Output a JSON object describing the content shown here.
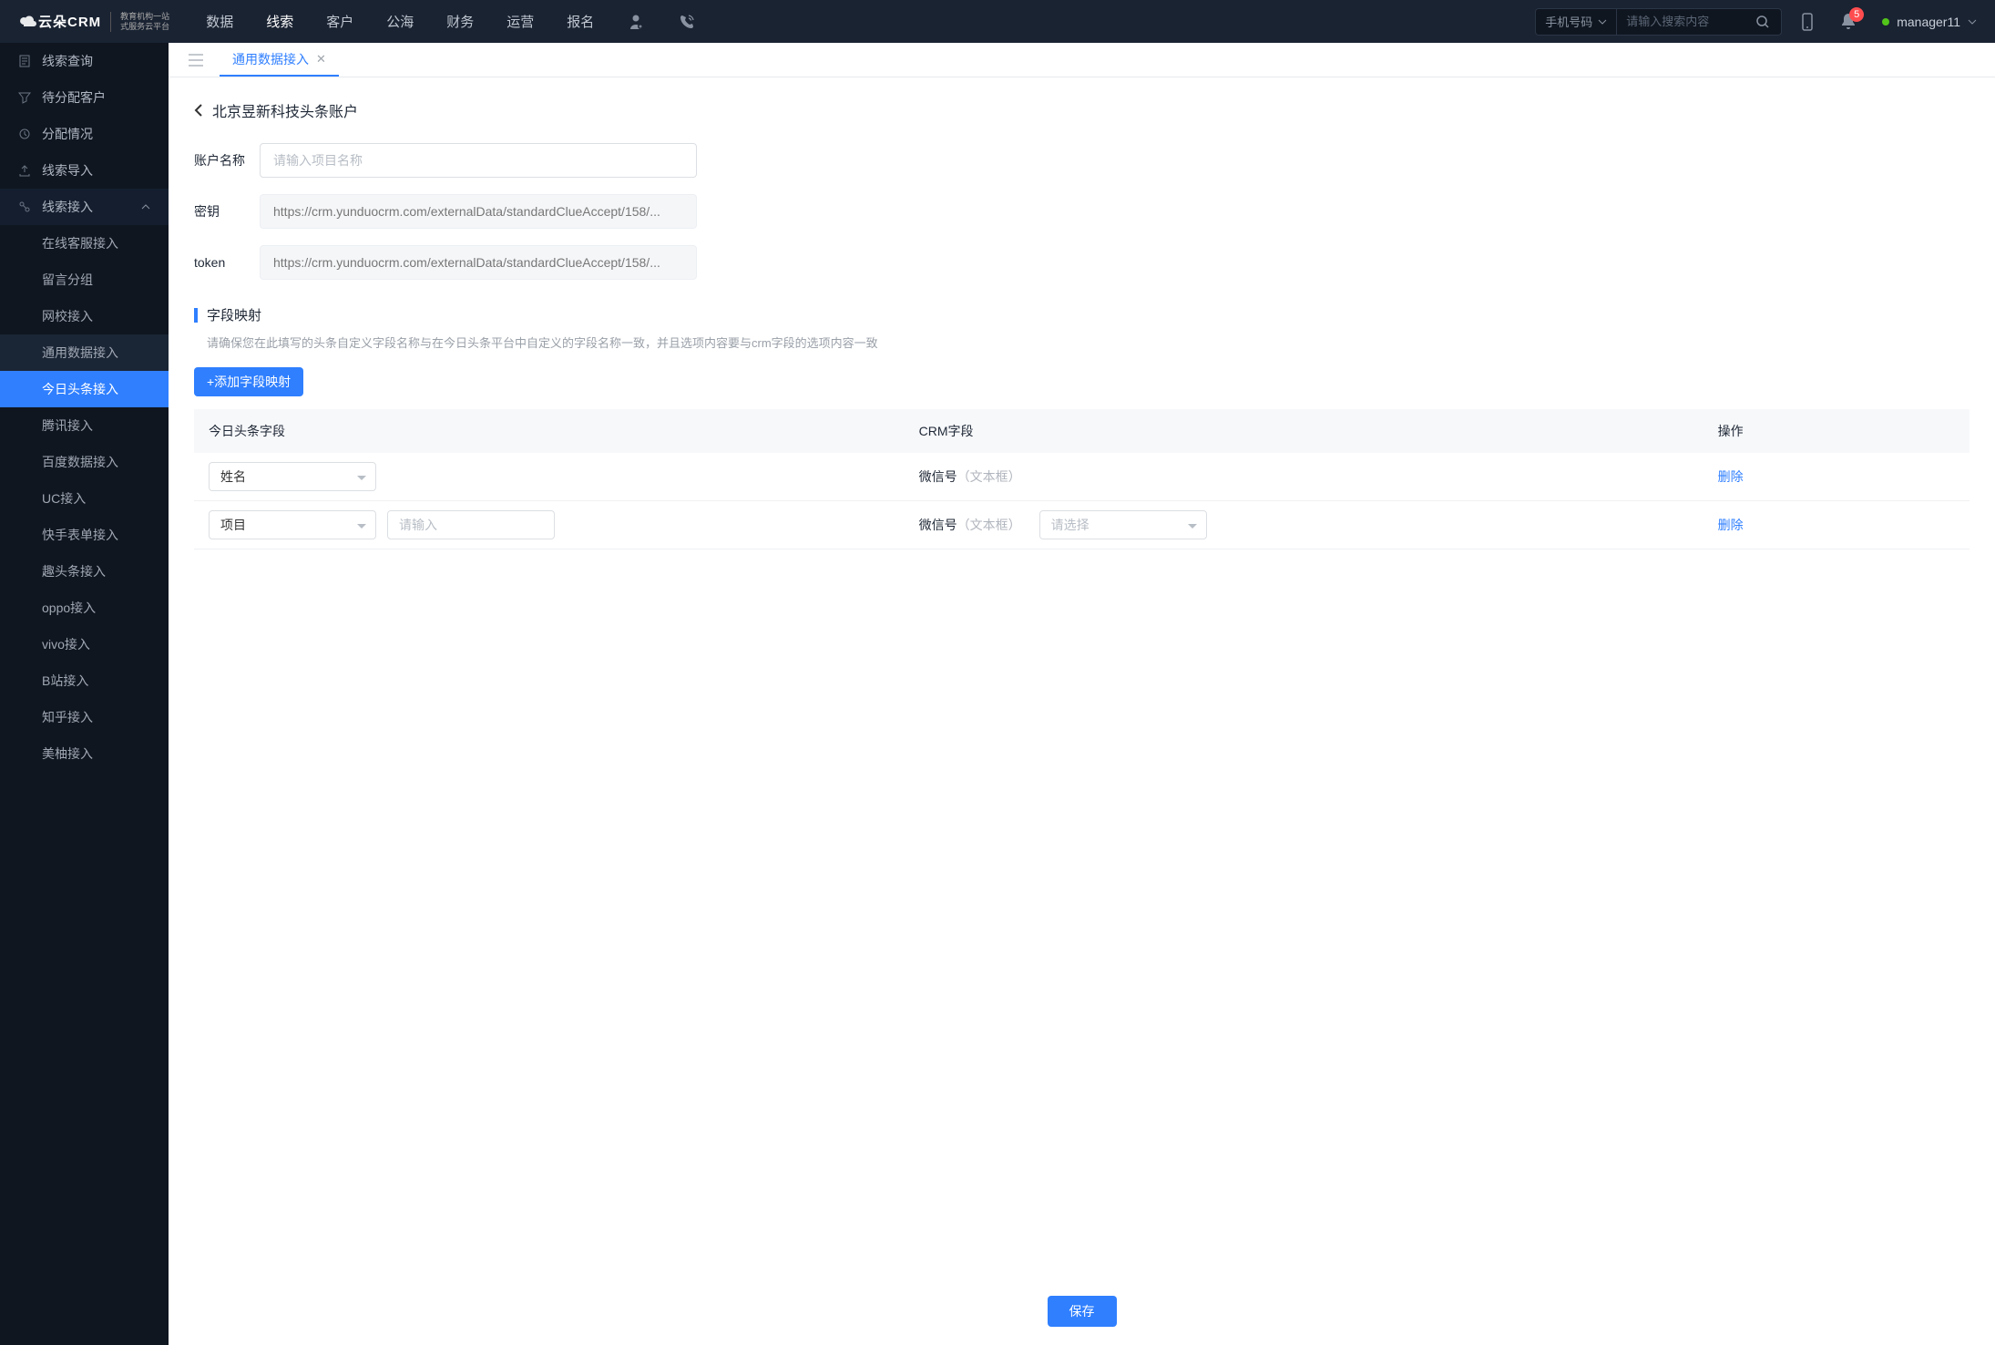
{
  "header": {
    "logo_main": "云朵CRM",
    "logo_sub_line1": "教育机构一站",
    "logo_sub_line2": "式服务云平台",
    "nav": [
      "数据",
      "线索",
      "客户",
      "公海",
      "财务",
      "运营",
      "报名"
    ],
    "nav_active": "线索",
    "search_select": "手机号码",
    "search_placeholder": "请输入搜索内容",
    "notif_count": "5",
    "user_name": "manager11"
  },
  "sidebar": {
    "items": [
      {
        "label": "线索查询",
        "icon": "doc-icon"
      },
      {
        "label": "待分配客户",
        "icon": "filter-icon"
      },
      {
        "label": "分配情况",
        "icon": "clock-icon"
      },
      {
        "label": "线索导入",
        "icon": "upload-icon"
      }
    ],
    "expanded_label": "线索接入",
    "subs": [
      "在线客服接入",
      "留言分组",
      "网校接入",
      "通用数据接入",
      "今日头条接入",
      "腾讯接入",
      "百度数据接入",
      "UC接入",
      "快手表单接入",
      "趣头条接入",
      "oppo接入",
      "vivo接入",
      "B站接入",
      "知乎接入",
      "美柚接入"
    ],
    "sub_active": "今日头条接入"
  },
  "tabs": {
    "0": {
      "label": "通用数据接入"
    }
  },
  "page": {
    "title": "北京昱新科技头条账户",
    "form": {
      "name_label": "账户名称",
      "name_placeholder": "请输入项目名称",
      "key_label": "密钥",
      "key_value": "https://crm.yunduocrm.com/externalData/standardClueAccept/158/...",
      "token_label": "token",
      "token_value": "https://crm.yunduocrm.com/externalData/standardClueAccept/158/..."
    },
    "mapping": {
      "title": "字段映射",
      "desc": "请确保您在此填写的头条自定义字段名称与在今日头条平台中自定义的字段名称一致，并且选项内容要与crm字段的选项内容一致",
      "add_btn": "+添加字段映射",
      "cols": [
        "今日头条字段",
        "CRM字段",
        "操作"
      ],
      "rows": [
        {
          "tt_field": "姓名",
          "crm_prefix": "微信号",
          "crm_hint": "（文本框）",
          "delete": "删除"
        },
        {
          "tt_field": "项目",
          "extra_placeholder": "请输入",
          "crm_prefix": "微信号",
          "crm_hint": "（文本框）",
          "select_placeholder": "请选择",
          "delete": "删除"
        }
      ]
    },
    "save": "保存"
  }
}
